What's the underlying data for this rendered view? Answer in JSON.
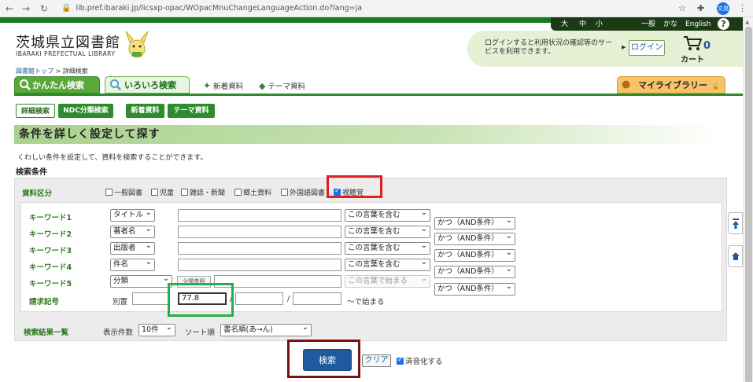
{
  "browser": {
    "url": "lib.pref.ibaraki.jp/licsxp-opac/WOpacMnuChangeLanguageAction.do?lang=ja",
    "profile": "文晃"
  },
  "topbar": {
    "font_large": "大",
    "font_medium": "中",
    "font_small": "小",
    "general": "一般",
    "kana": "かな",
    "english": "English",
    "help": "?"
  },
  "header": {
    "title": "茨城県立図書館",
    "subtitle": "IBARAKI PREFECTUAL LIBRARY",
    "login_message": "ログインすると利用状況の確認等のサービスを利用できます。",
    "login_button": "ログイン",
    "cart_count": "0",
    "cart_label": "カート"
  },
  "breadcrumb": {
    "home": "図書館トップ",
    "separator": " > ",
    "current": "詳細検索"
  },
  "tabs": {
    "simple": "かんたん検索",
    "advanced": "いろいろ検索",
    "new_items": "新着資料",
    "theme": "テーマ資料",
    "my_library": "マイライブラリー"
  },
  "subnav": {
    "detail": "詳細検索",
    "ndc": "NDC分類検索",
    "new_items": "新着資料",
    "theme": "テーマ資料"
  },
  "section": {
    "title": "条件を詳しく設定して探す",
    "description": "くわしい条件を設定して、資料を検索することができます。",
    "conditions_label": "検索条件"
  },
  "material": {
    "label": "資料区分",
    "items": [
      {
        "label": "一般図書",
        "checked": false
      },
      {
        "label": "児童",
        "checked": false
      },
      {
        "label": "雑誌・新聞",
        "checked": false
      },
      {
        "label": "郷土資料",
        "checked": false
      },
      {
        "label": "外国語図書",
        "checked": false
      },
      {
        "label": "視聴覚",
        "checked": true
      }
    ]
  },
  "keywords": [
    {
      "label": "キーワード1",
      "field": "タイトル",
      "match": "この言葉を含む"
    },
    {
      "label": "キーワード2",
      "field": "著者名",
      "match": "この言葉を含む"
    },
    {
      "label": "キーワード3",
      "field": "出版者",
      "match": "この言葉を含む"
    },
    {
      "label": "キーワード4",
      "field": "件名",
      "match": "この言葉を含む"
    },
    {
      "label": "キーワード5",
      "field": "分類",
      "match": "この言葉で始まる"
    }
  ],
  "operators": [
    "かつ（AND条件）",
    "かつ（AND条件）",
    "かつ（AND条件）",
    "かつ（AND条件）",
    "かつ（AND条件）"
  ],
  "classification_ref_button": "分類参照",
  "call_number": {
    "label": "請求記号",
    "prefix_label": "別置",
    "value": "77.8",
    "separator1": "/",
    "separator2": "/",
    "suffix": "〜で始まる"
  },
  "results": {
    "label": "検索結果一覧",
    "per_page_label": "表示件数",
    "per_page": "10件",
    "sort_label": "ソート順",
    "sort": "書名順(あ→ん)"
  },
  "actions": {
    "search": "検索",
    "clear": "クリア",
    "seion_label": "清音化する",
    "seion_checked": true
  },
  "colors": {
    "brand_green": "#2e8b2e",
    "search_blue": "#1f5a9e",
    "highlight_red": "#e02020",
    "highlight_green": "#22b04a",
    "highlight_darkred": "#7a1010"
  }
}
